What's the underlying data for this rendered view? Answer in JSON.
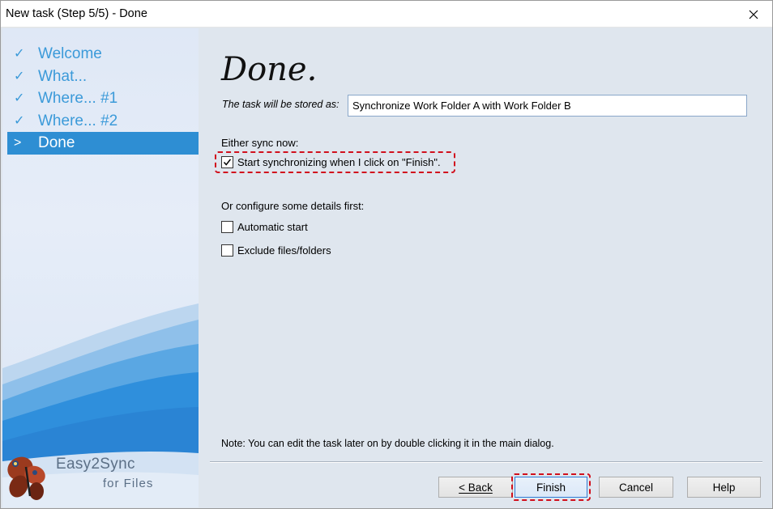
{
  "window": {
    "title": "New task (Step 5/5) - Done"
  },
  "sidebar": {
    "items": [
      {
        "mark": "✓",
        "label": "Welcome",
        "active": false
      },
      {
        "mark": "✓",
        "label": "What...",
        "active": false
      },
      {
        "mark": "✓",
        "label": "Where... #1",
        "active": false
      },
      {
        "mark": "✓",
        "label": "Where... #2",
        "active": false
      },
      {
        "mark": ">",
        "label": "Done",
        "active": true
      }
    ],
    "logo": {
      "name": "Easy2Sync",
      "sub": "for Files"
    }
  },
  "main": {
    "heading": "Done.",
    "store_label": "The task will be stored as:",
    "task_name": "Synchronize Work Folder A with Work Folder B",
    "sync_now_label": "Either sync now:",
    "start_sync": {
      "label": "Start synchronizing when I click on \"Finish\".",
      "checked": true
    },
    "configure_label": "Or configure some details first:",
    "automatic_start": {
      "label": "Automatic start",
      "checked": false
    },
    "exclude_files": {
      "label": "Exclude files/folders",
      "checked": false
    },
    "note": "Note: You can edit the task later on by double clicking it in the main dialog."
  },
  "buttons": {
    "back": "< Back",
    "finish": "Finish",
    "cancel": "Cancel",
    "help": "Help"
  },
  "colors": {
    "accent": "#2e8ed3",
    "nav_text": "#3b9ad9",
    "highlight": "#d1101d"
  }
}
